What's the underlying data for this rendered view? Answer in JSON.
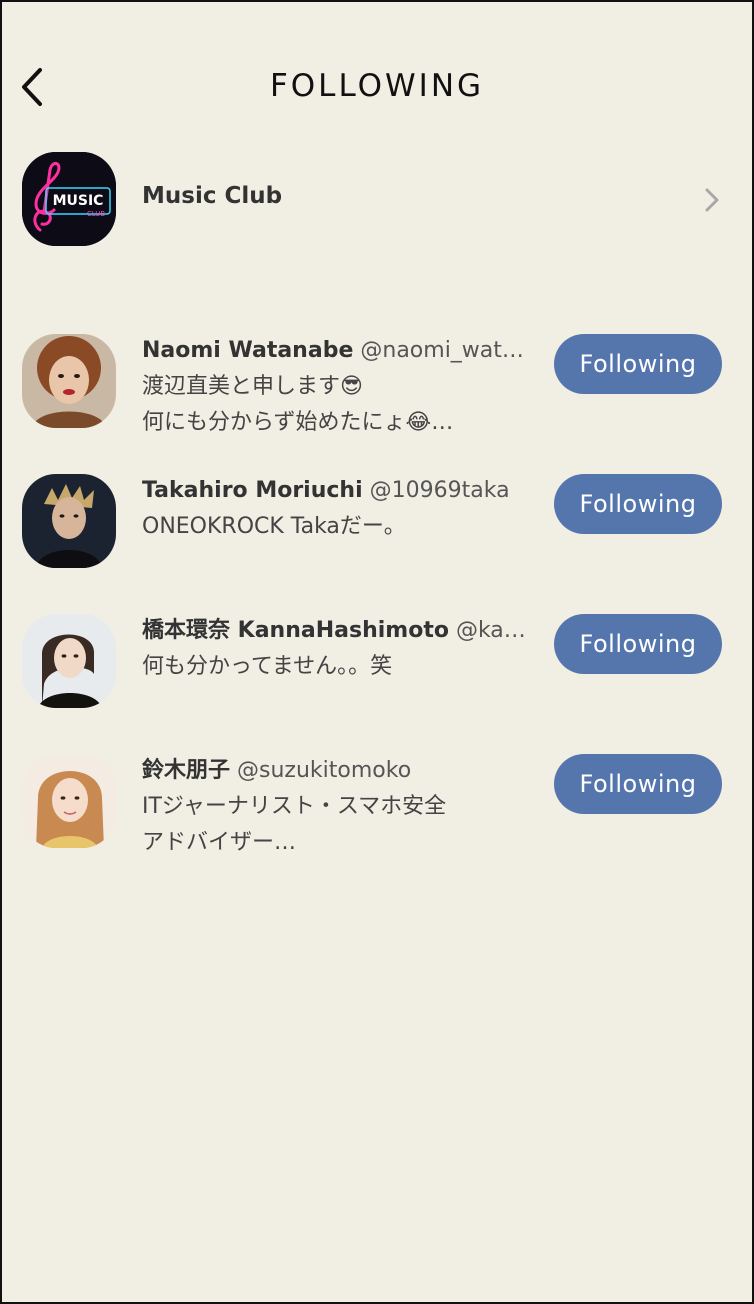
{
  "header": {
    "title": "FOLLOWING",
    "back_icon": "chevron-left-icon"
  },
  "club": {
    "name": "Music Club",
    "logo_text": "MUSIC",
    "logo_subtext": "CLUB",
    "chevron_icon": "chevron-right-icon"
  },
  "users": [
    {
      "name": "Naomi Watanabe",
      "handle": "@naomi_wat…",
      "bio_line1": "渡辺直美と申します😎",
      "bio_line2": "何にも分からず始めたにょ😂…",
      "button": "Following"
    },
    {
      "name": "Takahiro Moriuchi",
      "handle": "@10969taka",
      "bio_line1": "ONEOKROCK Takaだー。",
      "bio_line2": "",
      "button": "Following"
    },
    {
      "name": "橋本環奈 KannaHashimoto",
      "handle": "@ka…",
      "bio_line1": "何も分かってません。。笑",
      "bio_line2": "",
      "button": "Following"
    },
    {
      "name": "鈴木朋子",
      "handle": "@suzukitomoko",
      "bio_line1": "ITジャーナリスト・スマホ安全",
      "bio_line2": "アドバイザー…",
      "button": "Following"
    }
  ],
  "colors": {
    "background": "#f1eee4",
    "button": "#5576ad",
    "text_primary": "#333333"
  }
}
